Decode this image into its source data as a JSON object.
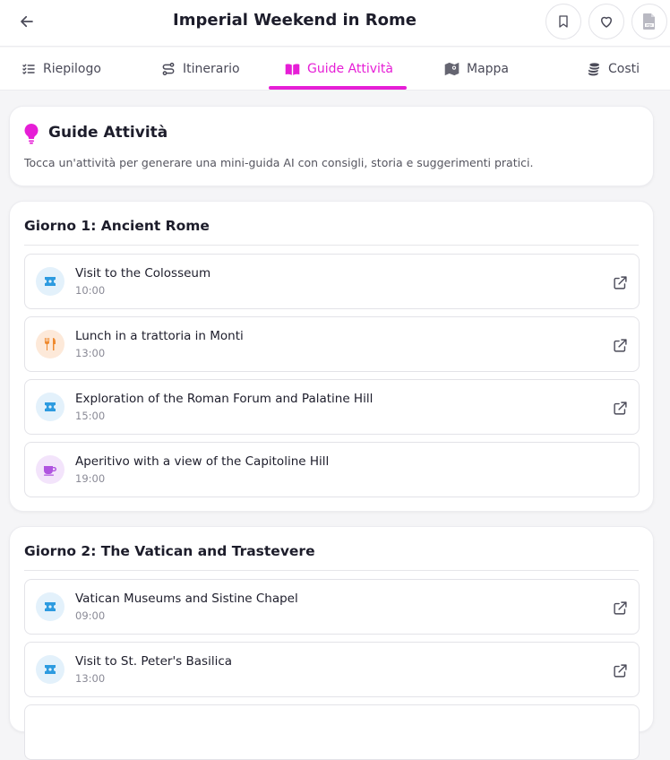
{
  "header": {
    "title": "Imperial Weekend in Rome"
  },
  "tabs": [
    {
      "label": "Riepilogo",
      "icon": "list-check-icon"
    },
    {
      "label": "Itinerario",
      "icon": "route-icon"
    },
    {
      "label": "Guide Attività",
      "icon": "book-open-icon",
      "active": true
    },
    {
      "label": "Mappa",
      "icon": "map-icon"
    },
    {
      "label": "Costi",
      "icon": "coins-icon"
    }
  ],
  "intro": {
    "title": "Guide Attività",
    "description": "Tocca un'attività per generare una mini-guida AI con consigli, storia e suggerimenti pratici."
  },
  "days": [
    {
      "title": "Giorno 1: Ancient Rome",
      "activities": [
        {
          "name": "Visit to the Colosseum",
          "time": "10:00",
          "icon": "ticket-icon",
          "has_link": true
        },
        {
          "name": "Lunch in a trattoria in Monti",
          "time": "13:00",
          "icon": "utensils-icon",
          "has_link": true
        },
        {
          "name": "Exploration of the Roman Forum and Palatine Hill",
          "time": "15:00",
          "icon": "ticket-icon",
          "has_link": true
        },
        {
          "name": "Aperitivo with a view of the Capitoline Hill",
          "time": "19:00",
          "icon": "coffee-cup-icon",
          "has_link": false
        }
      ]
    },
    {
      "title": "Giorno 2: The Vatican and Trastevere",
      "activities": [
        {
          "name": "Vatican Museums and Sistine Chapel",
          "time": "09:00",
          "icon": "ticket-icon",
          "has_link": true
        },
        {
          "name": "Visit to St. Peter's Basilica",
          "time": "13:00",
          "icon": "ticket-icon",
          "has_link": true
        }
      ]
    }
  ],
  "colors": {
    "accent": "#e61ed6",
    "ticket_bg": "#e3f1fb",
    "ticket_fg": "#2d9be0",
    "food_bg": "#fde9d9",
    "food_fg": "#ef8a2f",
    "drink_bg": "#f3e4fb",
    "drink_fg": "#b054e0"
  }
}
